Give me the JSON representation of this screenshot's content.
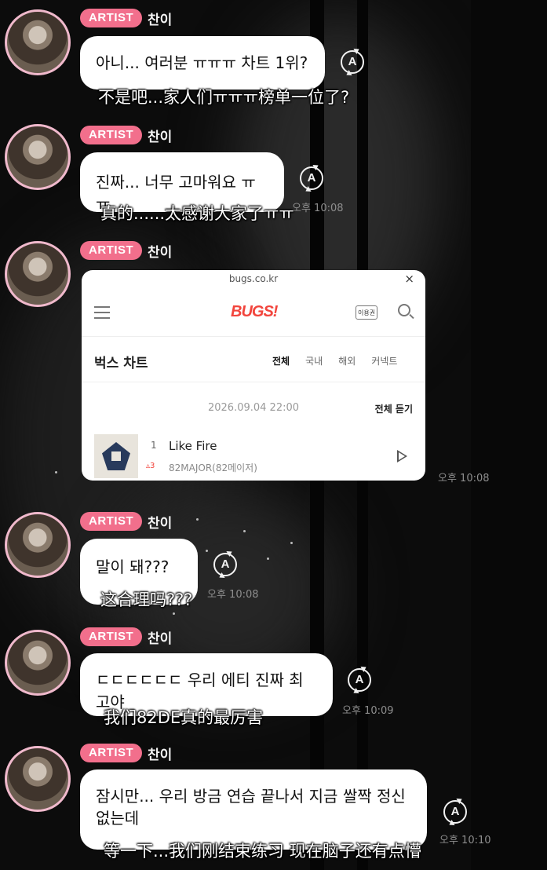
{
  "theme": {
    "badge_color": "#f26f8c",
    "avatar_ring": "#f0b9cc",
    "chart_accent": "#f2453d"
  },
  "messages": [
    {
      "badge": "ARTIST",
      "name": "찬이",
      "text_lines": [
        "아니... 여러분 ㅠㅠㅠ 차트 1위?"
      ],
      "time": "",
      "subtitle": "不是吧...家人们ㅠㅠㅠ榜单一位了?",
      "icon": "A"
    },
    {
      "badge": "ARTIST",
      "name": "찬이",
      "text_lines": [
        "진짜... 너무 고마워요 ㅠㅠ"
      ],
      "time": "오후 10:08",
      "subtitle": "真的......太感谢大家了ㅠㅠ",
      "icon": "A"
    },
    {
      "badge": "ARTIST",
      "name": "찬이",
      "time": "오후 10:08"
    },
    {
      "badge": "ARTIST",
      "name": "찬이",
      "text_lines": [
        "말이 돼???"
      ],
      "time": "오후 10:08",
      "subtitle": "这合理吗???",
      "icon": "A"
    },
    {
      "badge": "ARTIST",
      "name": "찬이",
      "text_lines": [
        "ㄷㄷㄷㄷㄷㄷ 우리 에티 진짜 최고야"
      ],
      "time": "오후 10:09",
      "subtitle": "我们82DE真的最厉害",
      "icon": "A"
    },
    {
      "badge": "ARTIST",
      "name": "찬이",
      "text_lines": [
        "잠시만... 우리 방금 연습 끝나서 지금 쌀짝 정신",
        "없는데"
      ],
      "time": "오후 10:10",
      "subtitle": "等一下...我们刚结束练习 现在脑子还有点懵",
      "icon": "A"
    }
  ],
  "chart_card": {
    "url": "bugs.co.kr",
    "close": "×",
    "logo": "BUGS!",
    "pass_label": "이용권",
    "title": "벅스 차트",
    "tabs": [
      "전체",
      "국내",
      "해외",
      "커넥트"
    ],
    "timestamp": "2026.09.04 22:00",
    "listen_all": "전체 듣기",
    "entry": {
      "rank": "1",
      "movement": "▵3",
      "song": "Like Fire",
      "artist": "82MAJOR(82메이저)"
    }
  }
}
